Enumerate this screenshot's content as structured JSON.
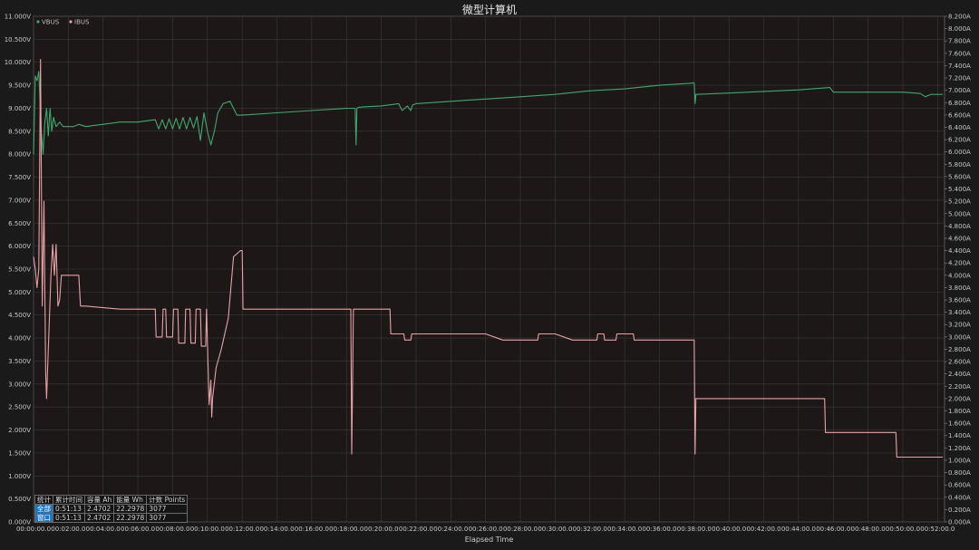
{
  "chart_data": {
    "type": "line",
    "title": "微型计算机",
    "xlabel": "Elapsed Time",
    "x_ticks": [
      "00:00:00.0",
      "00:02:00.0",
      "00:04:00.0",
      "00:06:00.0",
      "00:08:00.0",
      "00:10:00.0",
      "00:12:00.0",
      "00:14:00.0",
      "00:16:00.0",
      "00:18:00.0",
      "00:20:00.0",
      "00:22:00.0",
      "00:24:00.0",
      "00:26:00.0",
      "00:28:00.0",
      "00:30:00.0",
      "00:32:00.0",
      "00:34:00.0",
      "00:36:00.0",
      "00:38:00.0",
      "00:40:00.0",
      "00:42:00.0",
      "00:44:00.0",
      "00:46:00.0",
      "00:48:00.0",
      "00:50:00.0",
      "00:52:00.0"
    ],
    "xlim_minutes": [
      0,
      52.4
    ],
    "y_left": {
      "unit": "V",
      "ylim": [
        0,
        11
      ],
      "ticks": [
        "0.000V",
        "0.500V",
        "1.000V",
        "1.500V",
        "2.000V",
        "2.500V",
        "3.000V",
        "3.500V",
        "4.000V",
        "4.500V",
        "5.000V",
        "5.500V",
        "6.000V",
        "6.500V",
        "7.000V",
        "7.500V",
        "8.000V",
        "8.500V",
        "9.000V",
        "9.500V",
        "10.000V",
        "10.500V",
        "11.000V"
      ]
    },
    "y_right": {
      "unit": "A",
      "ylim": [
        0,
        8.2
      ],
      "ticks": [
        "0.000A",
        "0.200A",
        "0.400A",
        "0.600A",
        "0.800A",
        "1.000A",
        "1.200A",
        "1.400A",
        "1.600A",
        "1.800A",
        "2.000A",
        "2.200A",
        "2.400A",
        "2.600A",
        "2.800A",
        "3.000A",
        "3.200A",
        "3.400A",
        "3.600A",
        "3.800A",
        "4.000A",
        "4.200A",
        "4.400A",
        "4.600A",
        "4.800A",
        "5.000A",
        "5.200A",
        "5.400A",
        "5.600A",
        "5.800A",
        "6.000A",
        "6.200A",
        "6.400A",
        "6.600A",
        "6.800A",
        "7.000A",
        "7.200A",
        "7.400A",
        "7.600A",
        "7.800A",
        "8.000A",
        "8.200A"
      ]
    },
    "grid": true,
    "legend_position": "top-left",
    "series": [
      {
        "name": "VBUS",
        "axis": "left",
        "color": "#3ea86c",
        "x": [
          0,
          0.1,
          0.2,
          0.3,
          0.45,
          0.55,
          0.65,
          0.75,
          0.85,
          0.95,
          1.05,
          1.15,
          1.3,
          1.5,
          1.7,
          1.9,
          2.1,
          2.3,
          2.6,
          3.0,
          3.4,
          4.0,
          5.0,
          6.0,
          7.0,
          7.2,
          7.4,
          7.6,
          7.8,
          8.0,
          8.2,
          8.4,
          8.6,
          8.8,
          9.0,
          9.2,
          9.4,
          9.6,
          9.8,
          10.0,
          10.2,
          10.4,
          10.6,
          10.9,
          11.3,
          11.7,
          12.0,
          14.0,
          16.0,
          18.0,
          18.5,
          18.55,
          18.6,
          18.7,
          19.0,
          20.0,
          21.0,
          21.2,
          21.5,
          21.7,
          21.8,
          22.0,
          24.0,
          26.0,
          28.0,
          30.0,
          32.0,
          34.0,
          36.0,
          38.0,
          38.05,
          38.1,
          40.0,
          44.0,
          45.8,
          46.0,
          48.0,
          50.0,
          51.0,
          51.3,
          51.6,
          52.3
        ],
        "y": [
          8.0,
          9.7,
          9.6,
          9.8,
          8.5,
          8.0,
          8.7,
          9.0,
          8.4,
          9.0,
          8.5,
          8.8,
          8.6,
          8.7,
          8.6,
          8.6,
          8.6,
          8.6,
          8.65,
          8.6,
          8.62,
          8.65,
          8.7,
          8.7,
          8.75,
          8.55,
          8.75,
          8.55,
          8.77,
          8.55,
          8.78,
          8.55,
          8.8,
          8.55,
          8.8,
          8.57,
          8.82,
          8.3,
          8.9,
          8.5,
          8.2,
          8.5,
          8.9,
          9.1,
          9.15,
          8.85,
          8.85,
          8.9,
          8.95,
          9.0,
          9.0,
          8.2,
          9.0,
          9.02,
          9.03,
          9.05,
          9.1,
          8.95,
          9.05,
          8.95,
          9.07,
          9.1,
          9.15,
          9.2,
          9.25,
          9.3,
          9.38,
          9.42,
          9.5,
          9.55,
          9.1,
          9.3,
          9.33,
          9.4,
          9.45,
          9.35,
          9.35,
          9.35,
          9.32,
          9.25,
          9.3,
          9.3
        ]
      },
      {
        "name": "IBUS",
        "axis": "right",
        "color": "#e5a3a6",
        "x": [
          0,
          0.1,
          0.2,
          0.3,
          0.4,
          0.5,
          0.6,
          0.7,
          0.75,
          0.8,
          0.85,
          1.0,
          1.1,
          1.2,
          1.3,
          1.4,
          1.5,
          1.6,
          1.8,
          2.2,
          2.6,
          2.7,
          3.0,
          5.0,
          7.0,
          7.05,
          7.4,
          7.45,
          7.6,
          7.65,
          8.0,
          8.05,
          8.3,
          8.35,
          8.7,
          8.75,
          9.0,
          9.05,
          9.3,
          9.35,
          9.6,
          9.65,
          9.9,
          9.95,
          10.1,
          10.2,
          10.25,
          10.3,
          10.5,
          10.8,
          11.2,
          11.5,
          11.9,
          12.0,
          12.05,
          14.0,
          16.0,
          18.0,
          18.25,
          18.3,
          18.4,
          18.45,
          20.0,
          20.5,
          20.55,
          21.0,
          21.3,
          21.35,
          21.7,
          21.75,
          22.0,
          24.0,
          26.0,
          27.0,
          27.05,
          28.0,
          29.0,
          29.05,
          30.0,
          31.0,
          31.05,
          32.0,
          32.4,
          32.45,
          32.8,
          32.85,
          33.5,
          33.55,
          34.5,
          34.55,
          36.0,
          38.0,
          38.05,
          38.1,
          38.15,
          40.0,
          44.0,
          45.5,
          45.55,
          48.0,
          49.6,
          49.65,
          52.3
        ],
        "y": [
          4.3,
          4.1,
          3.8,
          4.1,
          7.5,
          3.5,
          5.2,
          2.4,
          2.0,
          2.4,
          2.8,
          4.0,
          4.5,
          4.0,
          4.5,
          3.5,
          3.6,
          4.0,
          4.0,
          4.0,
          4.0,
          3.5,
          3.5,
          3.45,
          3.45,
          3.0,
          3.0,
          3.45,
          3.45,
          3.0,
          3.0,
          3.45,
          3.45,
          2.9,
          2.9,
          3.45,
          3.45,
          2.9,
          2.9,
          3.45,
          3.45,
          2.85,
          2.85,
          3.45,
          1.9,
          2.3,
          1.7,
          2.0,
          2.5,
          2.8,
          3.3,
          4.3,
          4.4,
          4.4,
          3.45,
          3.45,
          3.45,
          3.45,
          3.45,
          1.1,
          3.45,
          3.45,
          3.45,
          3.45,
          3.05,
          3.05,
          3.05,
          2.95,
          2.95,
          3.05,
          3.05,
          3.05,
          3.05,
          2.95,
          2.95,
          2.95,
          2.95,
          3.05,
          3.05,
          2.95,
          2.95,
          2.95,
          2.95,
          3.05,
          3.05,
          2.95,
          2.95,
          3.05,
          3.05,
          2.95,
          2.95,
          2.95,
          1.1,
          2.0,
          2.0,
          2.0,
          2.0,
          2.0,
          1.45,
          1.45,
          1.45,
          1.05,
          1.05
        ]
      }
    ]
  },
  "stats_table": {
    "headers": [
      "统计",
      "累计时间",
      "容量 Ah",
      "能量 Wh",
      "计数 Points"
    ],
    "rows": [
      [
        "全部",
        "0:51:13",
        "2.4702",
        "22.2978",
        "3077"
      ],
      [
        "窗口",
        "0:51:13",
        "2.4702",
        "22.2978",
        "3077"
      ]
    ]
  },
  "colors": {
    "background": "#1a1a1a",
    "plot_background": "#1e1717",
    "grid": "#3a3a3a",
    "vbus": "#3ea86c",
    "ibus": "#e5a3a6",
    "highlight": "#1e73be"
  }
}
